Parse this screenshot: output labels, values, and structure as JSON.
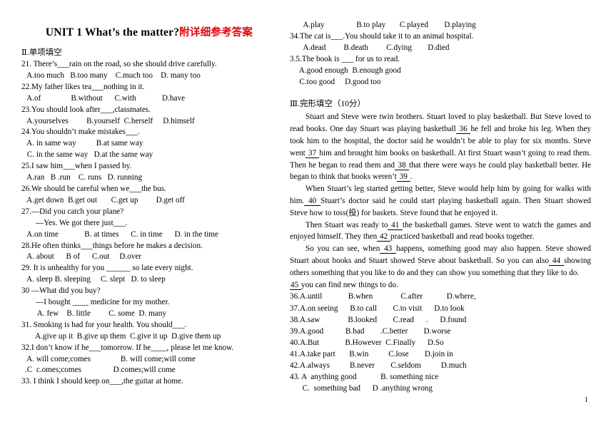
{
  "title": {
    "english": "UNIT 1  What’s the matter?",
    "chinese": "附详细参考答案"
  },
  "colors": {
    "title_accent": "#e8000b",
    "text": "#000000",
    "page_background": "#ffffff"
  },
  "left_column": {
    "section_header": "Ⅱ.单项填空",
    "questions": [
      {
        "stem": "21. There’s___rain on the road, so she should drive carefully.",
        "options": " A.too much   B.too many    C.much too    D. many too"
      },
      {
        "stem": "22.My father likes tea___nothing in it.",
        "options": " A.of               B.without      C.with             D.have"
      },
      {
        "stem": "23.You should look after___,classmates.",
        "options": " A.yourselves         B.yourself  C.herself     D.himself"
      },
      {
        "stem": "24.You shouldn’t make mistakes___.",
        "options_line1": " A. in same way          B.at same way",
        "options_line2": " C. in the same way   D.at the same way"
      },
      {
        "stem": "25.I saw him___when I passed by.",
        "options": " A.ran   B .run    C. runs   D. running"
      },
      {
        "stem": "26.We should be careful when we___the bus.",
        "options": " A.get down  B.get out       C.get up         D.get off"
      },
      {
        "stem": "27.—Did you catch your plane?",
        "sub": "—Yes. We got there just___.",
        "options": " A.on time             B. at times      C. in time      D. in the time"
      },
      {
        "stem": "28.He often thinks___things before he makes a decision.",
        "options": " A. about      B of      C.out     D.over"
      },
      {
        "stem": "29. It is unhealthy for you ______ so late every night.",
        "options": " A. sleep B. sleeping     C. slept   D. to sleep"
      },
      {
        "stem": "30 —What did you buy?",
        "sub": "—I bought ____ medicine for my mother.",
        "options": "   A. few    B. little         C. some  D. many"
      },
      {
        "stem": "31. Smoking is bad for your health. You should___.",
        "options": "  A.give up it  B.give up them  C.give it up  D.give them up"
      },
      {
        "stem": "32.I don’t know if he___tomorrow. If he____, please let me know.",
        "options_line1": " A. will come;comes               B. will come;will come",
        "options_line2": ".C  c.omes;comes                D.comes;will come"
      },
      {
        "stem": "33. I think I should keep on___,the guitar at home."
      }
    ]
  },
  "right_column": {
    "continued_options": {
      "q33_options": "     A.play                B.to play       C.played        D.playing"
    },
    "questions": [
      {
        "stem": "34.The cat is___.You should take it to an animal hospital.",
        "options": "     A.dead         B.death         C.dying        D.died"
      },
      {
        "stem": "3.5.The book is ___  for us to read.",
        "options_line1": "   A.good enough  B.enough good",
        "options_line2": "   C.too good     D.good too"
      }
    ],
    "section_header": "Ⅲ.完形填空（10分）",
    "passage": [
      {
        "indent": true,
        "parts": [
          {
            "t": "Stuart and Steve were twin brothers. Stuart loved to play basketball. But Steve loved to read books. One day Stuart was playing basketball"
          },
          {
            "t": " 36 ",
            "blank": true
          },
          {
            "t": "he fell and broke his leg. When they took him to the hospital, the doctor said he wouldn’t be able to play for six months. Steve went"
          },
          {
            "t": " 37 ",
            "blank": true
          },
          {
            "t": "him and brought him books on basketball. At first Stuart wasn’t going to read them. Then he began to read them and"
          },
          {
            "t": " 38 ",
            "blank": true
          },
          {
            "t": "that there were ways he could play basketball better. He began to think that books weren’t"
          },
          {
            "t": " 39 ",
            "blank": true
          },
          {
            "t": "."
          }
        ]
      },
      {
        "indent": true,
        "parts": [
          {
            "t": "When Stuart’s leg started getting better, Steve would help him by going for walks with him."
          },
          {
            "t": " 40 ",
            "blank": true
          },
          {
            "t": "Stuart’s doctor said he could start playing basketball again. Then Stuart showed Steve how to toss(投) for baskets. Steve found that he enjoyed it."
          }
        ]
      },
      {
        "indent": true,
        "parts": [
          {
            "t": "Then Stuart was ready to"
          },
          {
            "t": " 41 ",
            "blank": true
          },
          {
            "t": "the basketball games. Steve went to watch the games and enjoyed himself. They then"
          },
          {
            "t": " 42 ",
            "blank": true
          },
          {
            "t": "practiced basketball and read books together."
          }
        ]
      },
      {
        "indent": true,
        "parts": [
          {
            "t": "So you can see, when"
          },
          {
            "t": " 43 ",
            "blank": true
          },
          {
            "t": "happens, something good may also happen. Steve showed Stuart about books and Stuart showed Steve about basketball. So you can also"
          },
          {
            "t": " 44 ",
            "blank": true
          },
          {
            "t": "showing others something that you like to do and they can show you something that they like to do."
          }
        ]
      },
      {
        "indent": false,
        "parts": [
          {
            "t": "45 ",
            "blank": true
          },
          {
            "t": "you can find new things to do."
          }
        ]
      }
    ],
    "cloze_options": [
      {
        "text": "36.A.until             B.when              C.after            D.where,"
      },
      {
        "text": "37.A.on seeing      B.to call        C.to visit      D.to look"
      },
      {
        "text": "38.A.saw              B.looked        C.read      .      D.found"
      },
      {
        "text": "39.A.good           B.bad        .C.better        D.worse"
      },
      {
        "text": "40.A.But             B.However  C.Finally      D.So"
      },
      {
        "text": "41.A.take part       B.win          C.lose        D.join in"
      },
      {
        "text": "42.A.always          B.never        C.seldom          D.much"
      },
      {
        "text": "43. A  anything good            B. something nice"
      },
      {
        "text": "  C.  something bad      D .anything wrong",
        "sub": true
      }
    ]
  },
  "page_number": "1"
}
